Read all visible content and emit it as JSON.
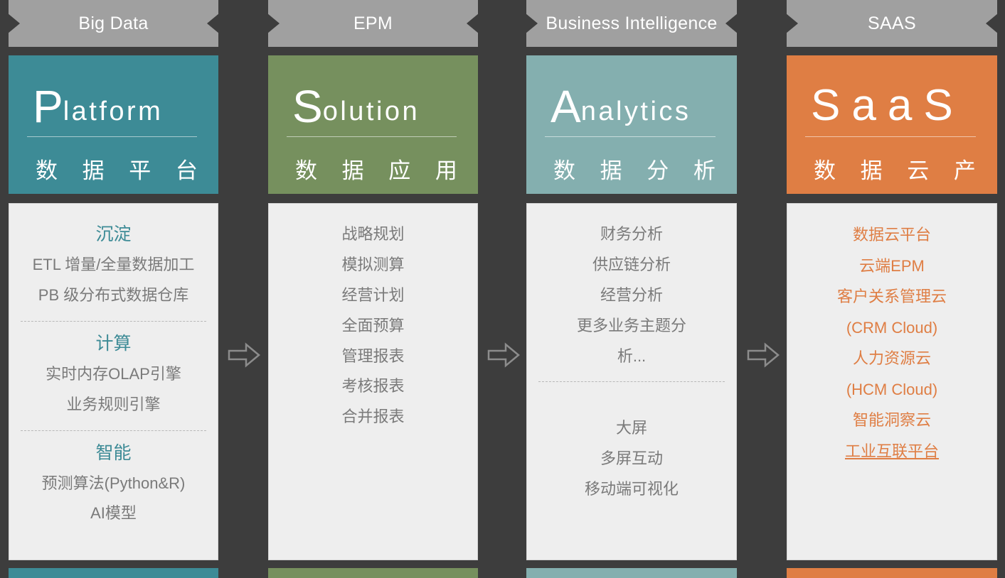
{
  "palette": {
    "background": "#3d3d3d",
    "banner": "#a0a0a0",
    "panel": "#eeeeee",
    "teal": "#3d8b96",
    "green": "#76905e",
    "lightteal": "#84afaf",
    "orange": "#df7e44",
    "body_text": "#7a7a7a",
    "arrow": "#8c8c8c"
  },
  "columns": [
    {
      "banner": "Big Data",
      "accent": "#3d8b96",
      "title_cap": "P",
      "title_rest": "latform",
      "title_cn": "数 据 平 台",
      "title_style": "standard",
      "sections": [
        {
          "heading": "沉淀",
          "heading_color": "#3d8b96",
          "items": [
            "ETL 增量/全量数据加工",
            "PB 级分布式数据仓库"
          ],
          "divider_after": true
        },
        {
          "heading": "计算",
          "heading_color": "#3d8b96",
          "items": [
            "实时内存OLAP引擎",
            "业务规则引擎"
          ],
          "divider_after": true
        },
        {
          "heading": "智能",
          "heading_color": "#3d8b96",
          "items": [
            "预测算法(Python&R)",
            "AI模型"
          ],
          "divider_after": false
        }
      ]
    },
    {
      "banner": "EPM",
      "accent": "#76905e",
      "title_cap": "S",
      "title_rest": "olution",
      "title_cn": "数 据 应 用",
      "title_style": "standard",
      "sections": [
        {
          "heading": "",
          "heading_color": "",
          "items": [
            "战略规划",
            "模拟测算",
            "经营计划",
            "全面预算",
            "管理报表",
            "考核报表",
            "合并报表"
          ],
          "divider_after": false
        }
      ]
    },
    {
      "banner": "Business Intelligence",
      "accent": "#84afaf",
      "title_cap": "A",
      "title_rest": "nalytics",
      "title_cn": "数 据 分 析",
      "title_style": "standard",
      "sections": [
        {
          "heading": "",
          "heading_color": "",
          "items": [
            "财务分析",
            "供应链分析",
            "经营分析",
            "更多业务主题分",
            "析..."
          ],
          "divider_after": true
        },
        {
          "heading": "",
          "heading_color": "",
          "items": [
            "大屏",
            "多屏互动",
            "移动端可视化"
          ],
          "divider_after": false
        }
      ]
    },
    {
      "banner": "SAAS",
      "accent": "#df7e44",
      "title_cap": "S",
      "title_rest": "aaS",
      "title_cn": "数 据 云 产 品",
      "title_style": "wide",
      "sections": [
        {
          "heading": "",
          "heading_color": "",
          "items": [
            "数据云平台",
            "云端EPM",
            "客户关系管理云",
            "(CRM Cloud)",
            "人力资源云",
            "(HCM Cloud)",
            "智能洞察云",
            "工业互联平台"
          ],
          "item_color": "#df7e44",
          "underline_last": true,
          "divider_after": false
        }
      ]
    }
  ],
  "arrows": [
    {
      "name": "flow-arrow-1",
      "glyph": "⇒"
    },
    {
      "name": "flow-arrow-2",
      "glyph": "⇒"
    },
    {
      "name": "flow-arrow-3",
      "glyph": "⇒"
    }
  ]
}
